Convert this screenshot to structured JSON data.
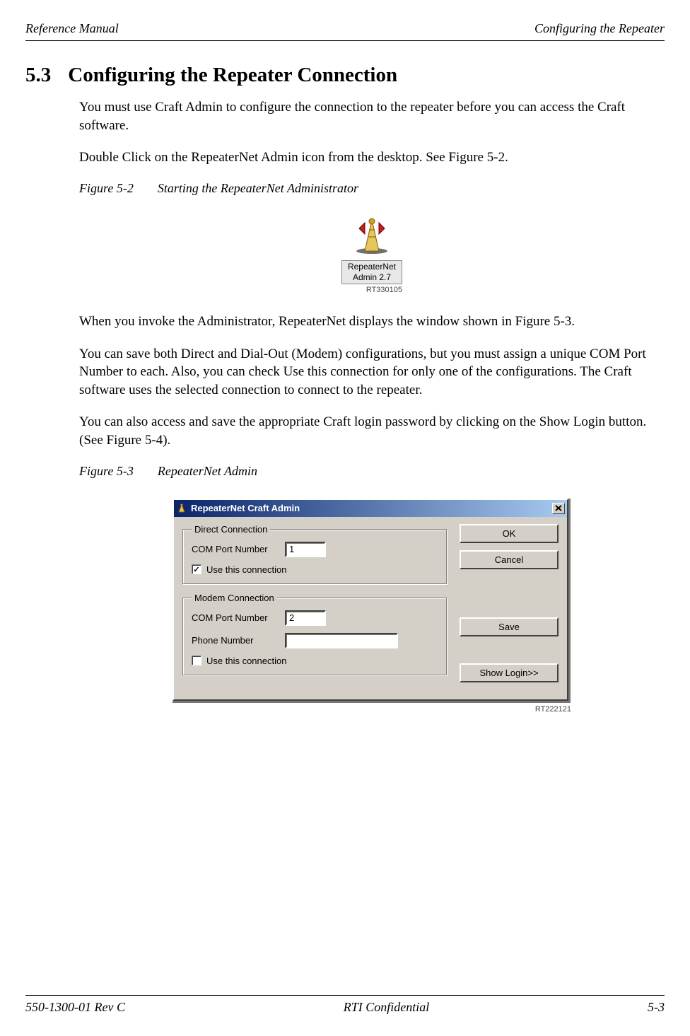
{
  "header": {
    "left": "Reference Manual",
    "right": "Configuring the Repeater"
  },
  "section": {
    "number": "5.3",
    "title": "Configuring the Repeater Connection"
  },
  "paras": {
    "p1": "You must use Craft Admin to configure the connection to the repeater before you can access the Craft software.",
    "p2": "Double Click on the RepeaterNet Admin icon from the desktop. See Figure 5-2.",
    "p3": "When you invoke the Administrator, RepeaterNet displays the window shown in Figure 5-3.",
    "p4": "You can save both Direct and Dial-Out (Modem) configurations, but you must assign a unique COM Port Number to each. Also, you can check Use this connection for only one of the configurations. The Craft software uses the selected connection to connect to the repeater.",
    "p5": "You can also access and save the appropriate Craft login password by clicking on the Show Login button. (See Figure 5-4)."
  },
  "fig1": {
    "label": "Figure 5-2",
    "caption": "Starting the RepeaterNet Administrator",
    "ref": "RT330105"
  },
  "fig2": {
    "label": "Figure 5-3",
    "caption": "RepeaterNet Admin",
    "ref": "RT222121"
  },
  "desktop_icon": {
    "line1": "RepeaterNet",
    "line2": "Admin 2.7"
  },
  "dialog": {
    "title": "RepeaterNet Craft Admin",
    "direct": {
      "legend": "Direct Connection",
      "com_label": "COM Port Number",
      "com_value": "1",
      "use_label": "Use this connection",
      "use_checked": true
    },
    "modem": {
      "legend": "Modem Connection",
      "com_label": "COM Port Number",
      "com_value": "2",
      "phone_label": "Phone Number",
      "phone_value": "",
      "use_label": "Use this connection",
      "use_checked": false
    },
    "buttons": {
      "ok": "OK",
      "cancel": "Cancel",
      "save": "Save",
      "show_login": "Show Login>>"
    }
  },
  "footer": {
    "left": "550-1300-01 Rev C",
    "center": "RTI Confidential",
    "right": "5-3"
  }
}
